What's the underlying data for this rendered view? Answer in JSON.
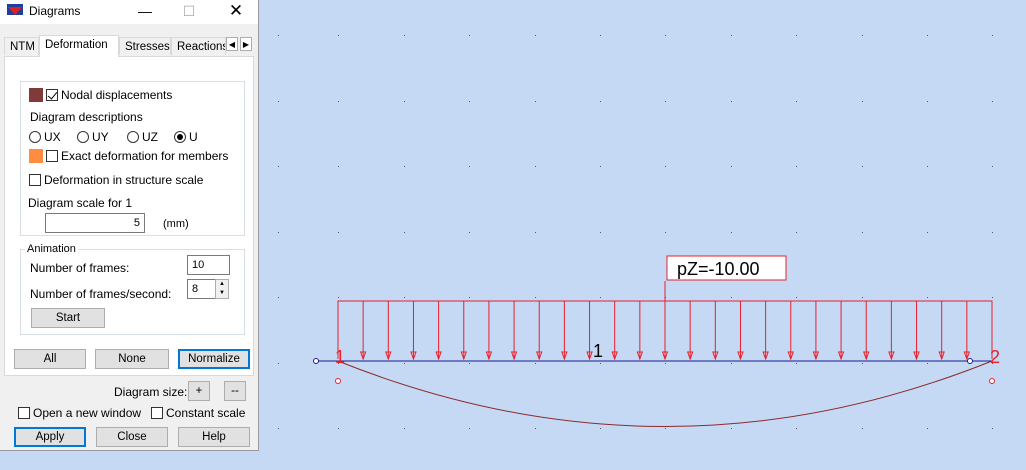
{
  "window": {
    "title": "Diagrams"
  },
  "tabs": [
    "NTM",
    "Deformation",
    "Stresses",
    "Reactions"
  ],
  "deformation": {
    "nodal_displacements": {
      "label": "Nodal displacements",
      "checked": true,
      "color": "#7f3a3a"
    },
    "diagram_descriptions_label": "Diagram descriptions",
    "radios": [
      {
        "label": "UX",
        "checked": false
      },
      {
        "label": "UY",
        "checked": false
      },
      {
        "label": "UZ",
        "checked": false
      },
      {
        "label": "U",
        "checked": true
      }
    ],
    "exact_deformation": {
      "label": "Exact deformation for members",
      "checked": false,
      "color": "#ff8c40"
    },
    "structure_scale": {
      "label": "Deformation in structure scale",
      "checked": false
    },
    "diagram_scale_label": "Diagram scale for 1",
    "diagram_scale_value": "5",
    "diagram_scale_unit": "(mm)"
  },
  "animation": {
    "group_label": "Animation",
    "frames_label": "Number of frames:",
    "frames_value": "10",
    "fps_label": "Number of frames/second:",
    "fps_value": "8",
    "start_label": "Start"
  },
  "buttons": {
    "all": "All",
    "none": "None",
    "normalize": "Normalize"
  },
  "diagram_size": {
    "label": "Diagram size:",
    "plus": "+",
    "minus": "--"
  },
  "options": {
    "open_new_window": {
      "label": "Open a new window",
      "checked": false
    },
    "constant_scale": {
      "label": "Constant scale",
      "checked": false
    }
  },
  "footer": {
    "apply": "Apply",
    "close": "Close",
    "help": "Help"
  },
  "structure": {
    "load_label": "pZ=-10.00",
    "member_label": "1",
    "node_labels": [
      "1",
      "2"
    ],
    "load_value": -10.0,
    "colors": {
      "background": "#c5d9f5",
      "load": "#e8202a",
      "member": "#1a1a8c",
      "deformation": "#8a2a2a",
      "grid": "#6a6a6a"
    }
  }
}
